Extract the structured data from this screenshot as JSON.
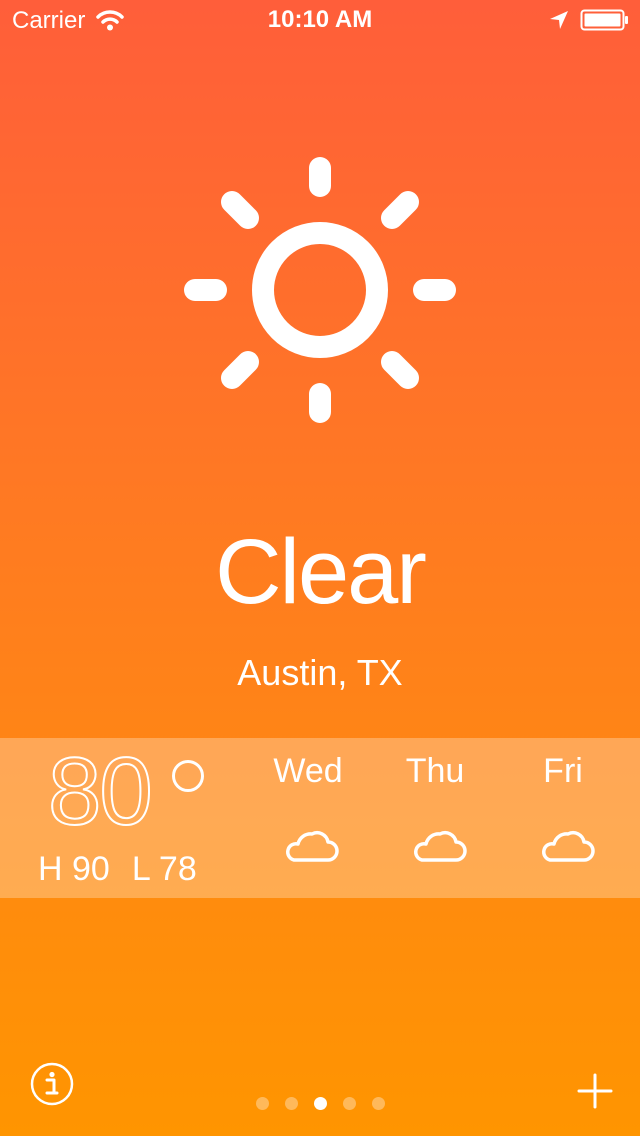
{
  "status_bar": {
    "carrier": "Carrier",
    "time": "10:10 AM"
  },
  "weather": {
    "condition": "Clear",
    "city": "Austin, TX",
    "current_temp": "80",
    "high": "H 90",
    "low": "L 78",
    "icon": "sun-icon"
  },
  "forecast": [
    {
      "day": "Wed",
      "icon": "cloud-icon"
    },
    {
      "day": "Thu",
      "icon": "cloud-icon"
    },
    {
      "day": "Fri",
      "icon": "cloud-icon"
    }
  ],
  "pager": {
    "page_count": 5,
    "current_page": 3
  },
  "colors": {
    "gradient_top": "#ff5e3a",
    "gradient_bottom": "#ff9500",
    "text": "#ffffff"
  }
}
